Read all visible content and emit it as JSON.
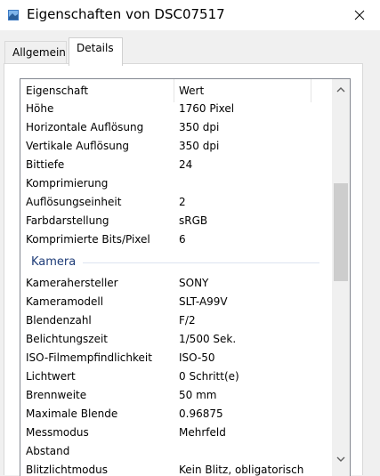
{
  "window": {
    "title": "Eigenschaften von DSC07517"
  },
  "tabs": [
    {
      "label": "Allgemein"
    },
    {
      "label": "Details"
    }
  ],
  "table": {
    "columns": [
      "Eigenschaft",
      "Wert"
    ],
    "rows_top": [
      {
        "name": "Höhe",
        "value": "1760 Pixel"
      },
      {
        "name": "Horizontale Auflösung",
        "value": "350 dpi"
      },
      {
        "name": "Vertikale Auflösung",
        "value": "350 dpi"
      },
      {
        "name": "Bittiefe",
        "value": "24"
      },
      {
        "name": "Komprimierung",
        "value": ""
      },
      {
        "name": "Auflösungseinheit",
        "value": "2"
      },
      {
        "name": "Farbdarstellung",
        "value": "sRGB"
      },
      {
        "name": "Komprimierte Bits/Pixel",
        "value": "6"
      }
    ],
    "section": "Kamera",
    "rows_camera": [
      {
        "name": "Kamerahersteller",
        "value": "SONY"
      },
      {
        "name": "Kameramodell",
        "value": "SLT-A99V"
      },
      {
        "name": "Blendenzahl",
        "value": "F/2"
      },
      {
        "name": "Belichtungszeit",
        "value": "1/500 Sek."
      },
      {
        "name": "ISO-Filmempfindlichkeit",
        "value": "ISO-50"
      },
      {
        "name": "Lichtwert",
        "value": "0 Schritt(e)"
      },
      {
        "name": "Brennweite",
        "value": "50 mm"
      },
      {
        "name": "Maximale Blende",
        "value": "0.96875"
      },
      {
        "name": "Messmodus",
        "value": "Mehrfeld"
      },
      {
        "name": "Abstand",
        "value": ""
      },
      {
        "name": "Blitzlichtmodus",
        "value": "Kein Blitz, obligatorisch"
      }
    ]
  }
}
